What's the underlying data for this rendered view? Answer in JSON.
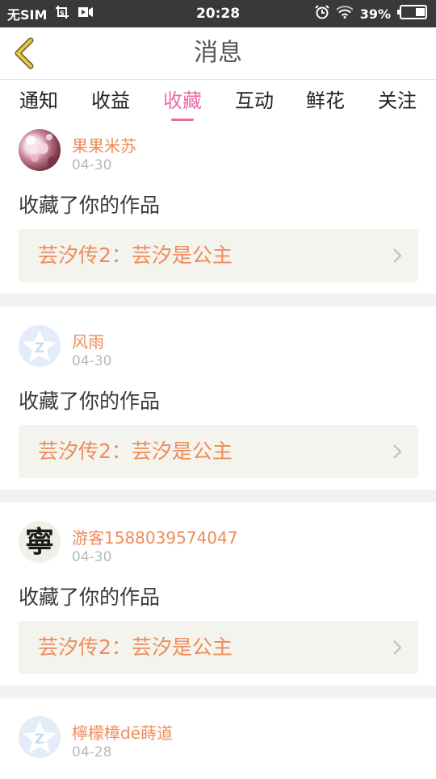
{
  "statusbar": {
    "carrier": "无SIM",
    "time": "20:28",
    "battery": "39%",
    "icons": [
      "screenshot-icon",
      "video-record-icon",
      "alarm-icon",
      "wifi-icon",
      "battery-icon"
    ]
  },
  "header": {
    "title": "消息",
    "back_icon": "chevron-left-icon"
  },
  "tabs": [
    {
      "label": "通知"
    },
    {
      "label": "收益"
    },
    {
      "label": "收藏",
      "active": true
    },
    {
      "label": "互动"
    },
    {
      "label": "鲜花"
    },
    {
      "label": "关注"
    }
  ],
  "items": [
    {
      "user": "果果米苏",
      "date": "04-30",
      "message": "收藏了你的作品",
      "work": "芸汐传2：芸汐是公主",
      "avatar": "photo"
    },
    {
      "user": "风雨",
      "date": "04-30",
      "message": "收藏了你的作品",
      "work": "芸汐传2：芸汐是公主",
      "avatar": "default"
    },
    {
      "user": "游客1588039574047",
      "date": "04-30",
      "message": "收藏了你的作品",
      "work": "芸汐传2：芸汐是公主",
      "avatar": "寧"
    },
    {
      "user": "檸檬樟dē蒔道",
      "date": "04-28",
      "avatar": "default"
    }
  ],
  "colors": {
    "accent": "#e46fa3",
    "username": "#ee8c5a",
    "statusbar": "#393939"
  }
}
